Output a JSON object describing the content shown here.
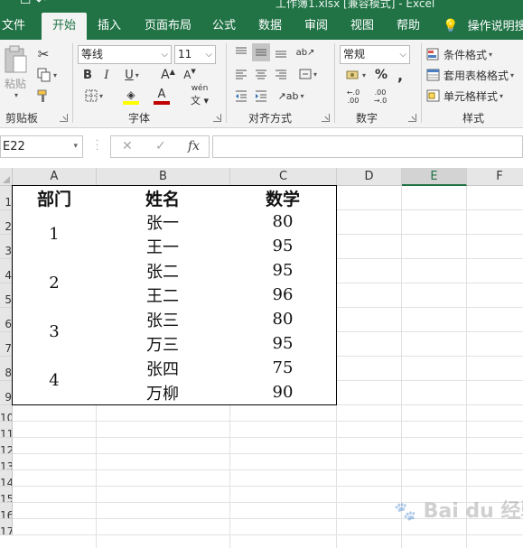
{
  "ribbon_tabs": {
    "file": "文件",
    "home": "开始",
    "insert": "插入",
    "page_layout": "页面布局",
    "formulas": "公式",
    "data": "数据",
    "review": "审阅",
    "view": "视图",
    "help": "帮助",
    "tell_me": "操作说明搜"
  },
  "title_partial": "工作簿1.xlsx [兼容模式] - Excel",
  "clipboard": {
    "paste_label": "粘贴",
    "group_label": "剪贴板"
  },
  "font": {
    "name_value": "等线",
    "size_value": "11",
    "bold": "B",
    "italic": "I",
    "underline": "U",
    "grow": "A",
    "shrink": "A",
    "font_color_letter": "A",
    "phonetic": "wén",
    "group_label": "字体",
    "highlight_color": "#ffff00",
    "font_color": "#c00000"
  },
  "alignment": {
    "group_label": "对齐方式"
  },
  "number": {
    "format_value": "常规",
    "percent": "%",
    "comma": ",",
    "inc_decimal": "←.0 .00",
    "dec_decimal": ".00 →.0",
    "group_label": "数字"
  },
  "styles": {
    "conditional": "条件格式",
    "table": "套用表格格式",
    "cell_styles": "单元格样式",
    "group_label": "样式"
  },
  "formula_bar": {
    "name_box": "E22",
    "cancel": "✕",
    "enter": "✓",
    "fx": "fx",
    "value": ""
  },
  "columns": [
    "A",
    "B",
    "C",
    "D",
    "E",
    "F"
  ],
  "selected_column": "E",
  "rows": [
    "1",
    "2",
    "3",
    "4",
    "5",
    "6",
    "7",
    "8",
    "9",
    "10",
    "11",
    "12",
    "13",
    "14",
    "15",
    "16",
    "17"
  ],
  "table": {
    "headers": [
      "部门",
      "姓名",
      "数学"
    ],
    "departments": [
      "1",
      "2",
      "3",
      "4"
    ],
    "names": [
      "张一",
      "王一",
      "张二",
      "王二",
      "张三",
      "万三",
      "张四",
      "万柳"
    ],
    "math": [
      "80",
      "95",
      "95",
      "96",
      "80",
      "95",
      "75",
      "90"
    ]
  },
  "watermark": "Bai du 经验"
}
